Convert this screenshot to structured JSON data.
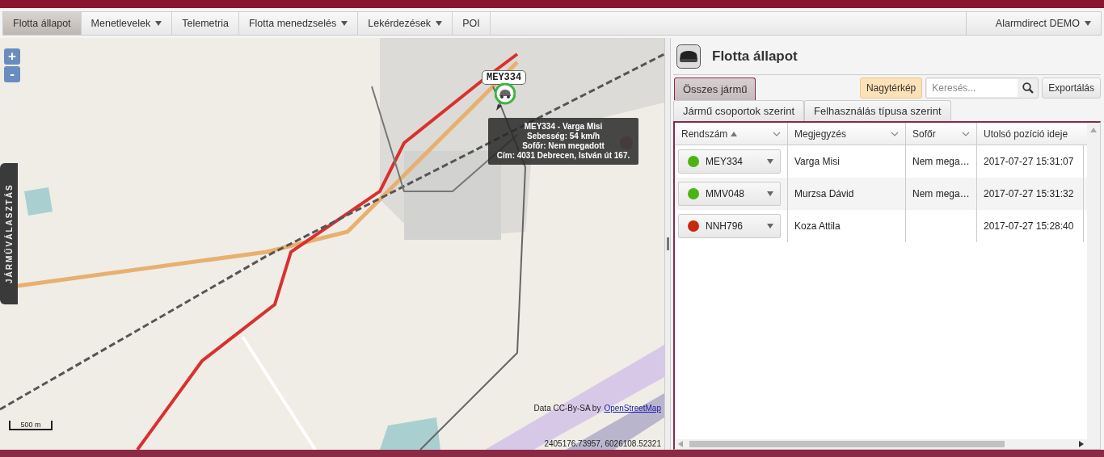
{
  "menu": [
    {
      "label": "Flotta állapot",
      "selected": true
    },
    {
      "label": "Menetlevelek",
      "selected": false,
      "dropdown": true
    },
    {
      "label": "Telemetria",
      "selected": false
    },
    {
      "label": "Flotta menedzselés",
      "selected": false,
      "dropdown": true
    },
    {
      "label": "Lekérdezések",
      "selected": false,
      "dropdown": true
    },
    {
      "label": "POI",
      "selected": false
    }
  ],
  "account": {
    "label": "Alarmdirect DEMO",
    "dropdown": true
  },
  "map": {
    "zoom_in": "+",
    "zoom_out": "-",
    "side_tab": "JÁRMŰVÁLASZTÁS",
    "marker_label": "MEY334",
    "tooltip": [
      "MEY334 - Varga Misi",
      "Sebesség: 54 km/h",
      "Sofőr: Nem megadott",
      "Cím: 4031 Debrecen, István út 167."
    ],
    "scale": "500 m",
    "attribution": "Data CC-By-SA by",
    "attribution_link": "OpenStreetMap",
    "coordinates": "2405176.73957, 6026108.52321"
  },
  "panel": {
    "title": "Flotta állapot",
    "tabs": [
      {
        "label": "Összes jármű",
        "selected": true
      }
    ],
    "subtabs": [
      {
        "label": "Jármű csoportok szerint",
        "selected": false
      },
      {
        "label": "Felhasználás típusa szerint",
        "selected": false
      }
    ],
    "map_button": "Nagytérkép",
    "search": {
      "placeholder": "Keresés..."
    },
    "export_button": "Exportálás",
    "columns": [
      {
        "label": "Rendszám",
        "sorted_ascending": true,
        "filter": true
      },
      {
        "label": "Megjegyzés",
        "filter": true
      },
      {
        "label": "Sofőr",
        "filter": true
      },
      {
        "label": "Utolsó pozíció ideje"
      }
    ],
    "rows": [
      {
        "plate": "MEY334",
        "color": "#4db312",
        "note": "Varga Misi",
        "driver": "Nem mega…",
        "time": "2017-07-27 15:31:07"
      },
      {
        "plate": "MMV048",
        "color": "#4db312",
        "note": "Murzsa Dávid",
        "driver": "Nem mega…",
        "time": "2017-07-27 15:31:32"
      },
      {
        "plate": "NNH796",
        "color": "#c8280e",
        "note": "Koza Attila",
        "time": "2017-07-27 15:28:40"
      }
    ]
  }
}
